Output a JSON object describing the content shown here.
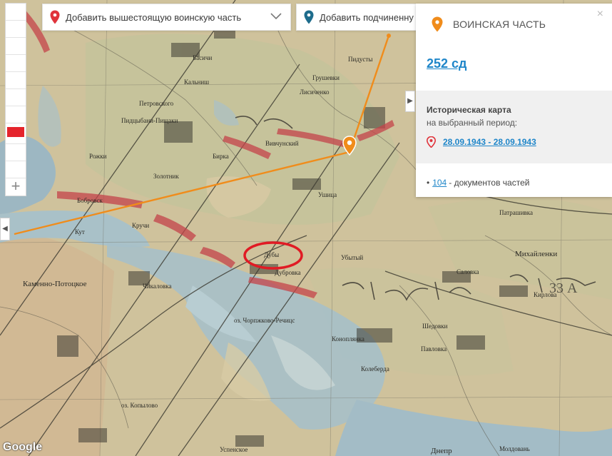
{
  "map": {
    "places": [
      "Петровского",
      "Пидцыбани-Пищаки",
      "Басичи",
      "Кальниш",
      "Рожки",
      "Золотник",
      "Бирка",
      "Вивчунский",
      "Бобровск",
      "Кручи",
      "Кут",
      "Дубы",
      "Дубровка",
      "Каменно-Потоцкое",
      "Чикаловка",
      "оз. Чорпжково-Речицс",
      "Коноплянка",
      "Павловка",
      "Колеберда",
      "Саловка",
      "Михайленки",
      "Патрашивка",
      "Шедовки",
      "Кирлова",
      "оз. Копылово",
      "Успенское",
      "Днепр",
      "Молдовань",
      "Убытый",
      "Грушевки",
      "Пидусты",
      "Ушица",
      "Лисиченко"
    ],
    "annotation_text": "33 А",
    "google_logo": "Google"
  },
  "toolbar": {
    "red_swatch_color": "#e5242c",
    "add_tool_icon": "plus-icon"
  },
  "top_bar": {
    "superior_unit_label": "Добавить вышестоящую воинскую часть",
    "subordinate_unit_label": "Добавить подчиненну"
  },
  "panel": {
    "title": "ВОИНСКАЯ ЧАСТЬ",
    "close_symbol": "×",
    "unit_name": "252 сд",
    "history_title": "Историческая карта",
    "history_subtitle": "на выбранный период:",
    "period": "28.09.1943 - 28.09.1943",
    "docs_bullet": "•",
    "docs_count": "104",
    "docs_label": "- документов частей"
  },
  "colors": {
    "route": "#f08c1b",
    "front_line": "#c4434a",
    "circle": "#e01b24",
    "link": "#1f86c9",
    "pin_red": "#e0343c",
    "pin_teal": "#1e6c8c"
  }
}
